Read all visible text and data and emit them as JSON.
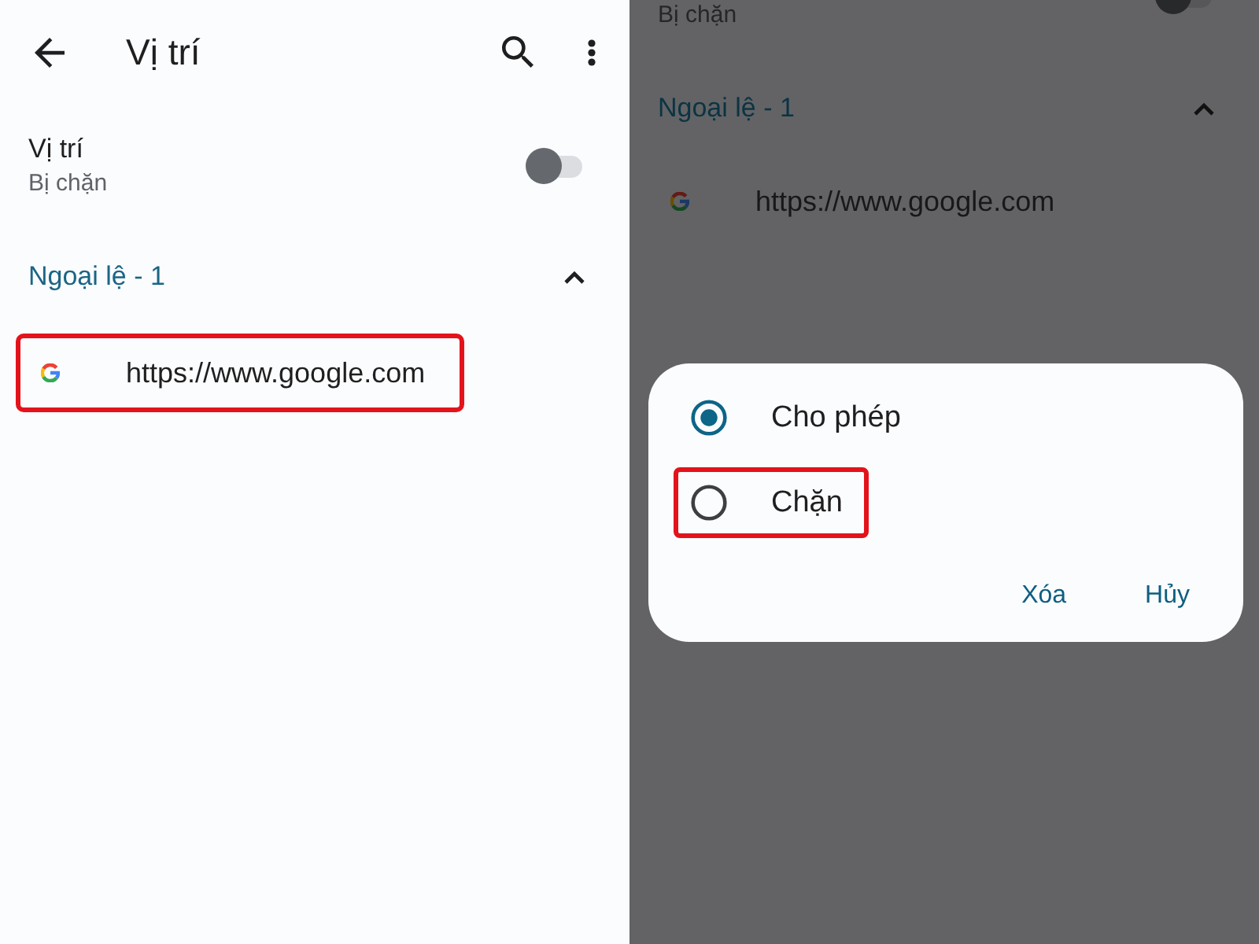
{
  "left_screen": {
    "toolbar": {
      "title": "Vị trí"
    },
    "setting": {
      "title": "Vị trí",
      "summary": "Bị chặn",
      "on": false
    },
    "section": {
      "title": "Ngoại lệ - 1",
      "expanded": true
    },
    "sites": [
      {
        "url": "https://www.google.com",
        "highlighted": true
      }
    ]
  },
  "right_screen": {
    "dimmed": true,
    "setting": {
      "summary": "Bị chặn",
      "on": false
    },
    "section": {
      "title": "Ngoại lệ - 1",
      "expanded": true
    },
    "sites": [
      {
        "url": "https://www.google.com"
      }
    ],
    "dialog": {
      "options": [
        {
          "label": "Cho phép",
          "selected": true,
          "highlighted": false
        },
        {
          "label": "Chặn",
          "selected": false,
          "highlighted": true
        }
      ],
      "buttons": [
        "Xóa",
        "Hủy"
      ]
    }
  }
}
